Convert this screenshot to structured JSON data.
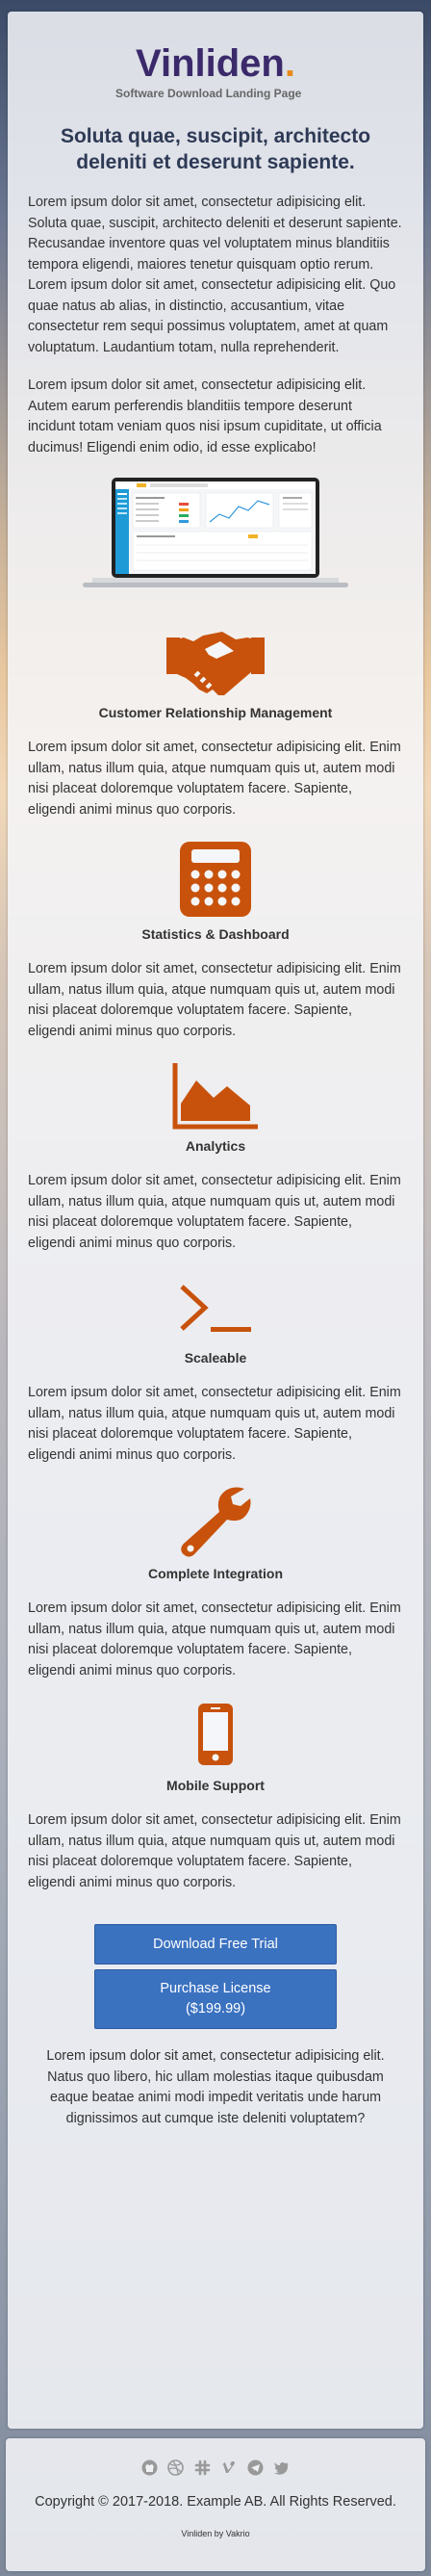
{
  "brand": {
    "name": "Vinliden",
    "dot": ".",
    "tagline": "Software Download Landing Page"
  },
  "headline": "Soluta quae, suscipit, architecto deleniti et deserunt sapiente.",
  "intro_paragraphs": [
    "Lorem ipsum dolor sit amet, consectetur adipisicing elit. Soluta quae, suscipit, architecto deleniti et deserunt sapiente. Recusandae inventore quas vel voluptatem minus blanditiis tempora eligendi, maiores tenetur quisquam optio rerum. Lorem ipsum dolor sit amet, consectetur adipisicing elit. Quo quae natus ab alias, in distinctio, accusantium, vitae consectetur rem sequi possimus voluptatem, amet at quam voluptatum. Laudantium totam, nulla reprehenderit.",
    "Lorem ipsum dolor sit amet, consectetur adipisicing elit. Autem earum perferendis blanditiis tempore deserunt incidunt totam veniam quos nisi ipsum cupiditate, ut officia ducimus! Eligendi enim odio, id esse explicabo!"
  ],
  "features": [
    {
      "icon": "handshake-icon",
      "title": "Customer Relationship Management",
      "text": "Lorem ipsum dolor sit amet, consectetur adipisicing elit. Enim ullam, natus illum quia, atque numquam quis ut, autem modi nisi placeat doloremque voluptatem facere. Sapiente, eligendi animi minus quo corporis."
    },
    {
      "icon": "calculator-icon",
      "title": "Statistics & Dashboard",
      "text": "Lorem ipsum dolor sit amet, consectetur adipisicing elit. Enim ullam, natus illum quia, atque numquam quis ut, autem modi nisi placeat doloremque voluptatem facere. Sapiente, eligendi animi minus quo corporis."
    },
    {
      "icon": "area-chart-icon",
      "title": "Analytics",
      "text": "Lorem ipsum dolor sit amet, consectetur adipisicing elit. Enim ullam, natus illum quia, atque numquam quis ut, autem modi nisi placeat doloremque voluptatem facere. Sapiente, eligendi animi minus quo corporis."
    },
    {
      "icon": "terminal-icon",
      "title": "Scaleable",
      "text": "Lorem ipsum dolor sit amet, consectetur adipisicing elit. Enim ullam, natus illum quia, atque numquam quis ut, autem modi nisi placeat doloremque voluptatem facere. Sapiente, eligendi animi minus quo corporis."
    },
    {
      "icon": "wrench-icon",
      "title": "Complete Integration",
      "text": "Lorem ipsum dolor sit amet, consectetur adipisicing elit. Enim ullam, natus illum quia, atque numquam quis ut, autem modi nisi placeat doloremque voluptatem facere. Sapiente, eligendi animi minus quo corporis."
    },
    {
      "icon": "mobile-phone-icon",
      "title": "Mobile Support",
      "text": "Lorem ipsum dolor sit amet, consectetur adipisicing elit. Enim ullam, natus illum quia, atque numquam quis ut, autem modi nisi placeat doloremque voluptatem facere. Sapiente, eligendi animi minus quo corporis."
    }
  ],
  "buttons": {
    "download": "Download Free Trial",
    "purchase_line1": "Purchase License",
    "purchase_line2": "($199.99)"
  },
  "closing": "Lorem ipsum dolor sit amet, consectetur adipisicing elit. Natus quo libero, hic ullam molestias itaque quibusdam eaque beatae animi modi impedit veritatis unde harum dignissimos aut cumque iste deleniti voluptatem?",
  "footer": {
    "social_icons": [
      "github-icon",
      "dribbble-icon",
      "slack-icon",
      "vimeo-icon",
      "telegram-icon",
      "twitter-icon"
    ],
    "copyright": "Copyright © 2017-2018. Example AB. All Rights Reserved.",
    "credit": "Vinliden by Vakrio"
  },
  "colors": {
    "accent": "#c8520b",
    "brand": "#3b2a6b",
    "button": "#3b72c0",
    "dot": "#e88a1a"
  }
}
